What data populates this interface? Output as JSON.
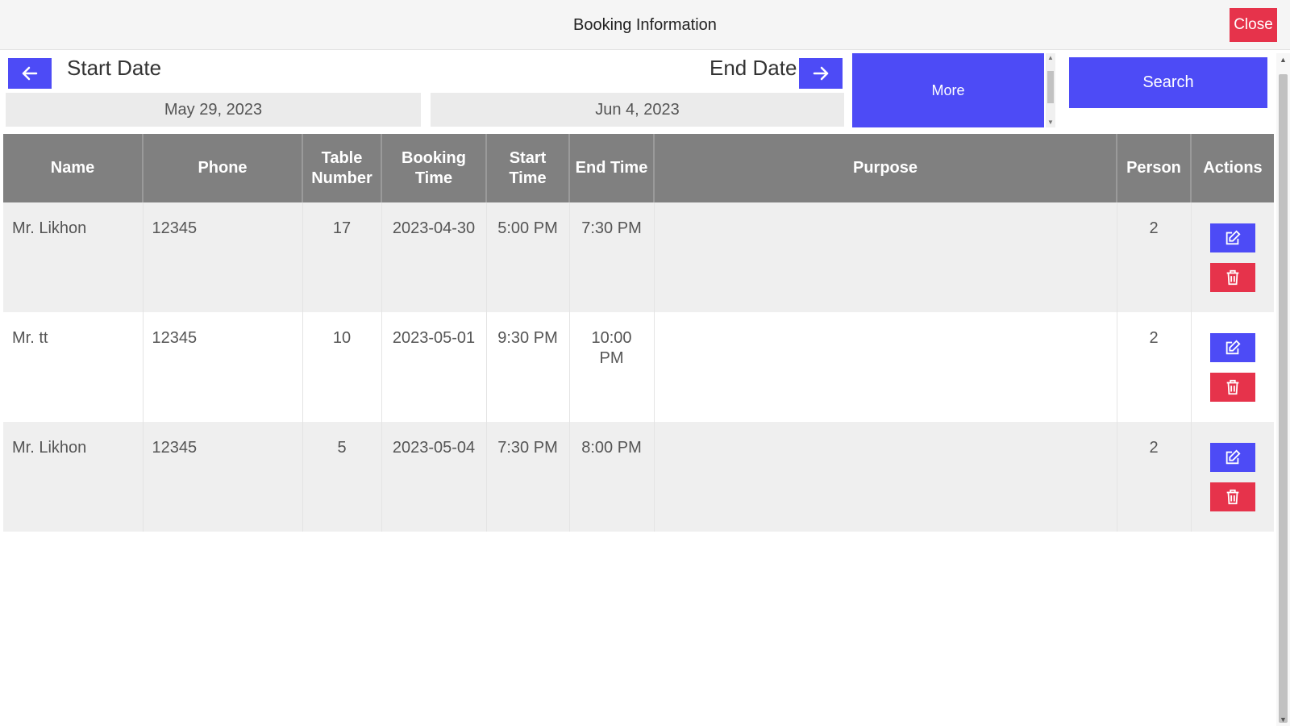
{
  "header": {
    "title": "Booking Information",
    "close_label": "Close"
  },
  "filters": {
    "start_label": "Start Date",
    "end_label": "End Date",
    "start_value": "May 29, 2023",
    "end_value": "Jun 4, 2023",
    "more_label": "More",
    "search_label": "Search",
    "prev_icon": "arrow-left-icon",
    "next_icon": "arrow-right-icon"
  },
  "table": {
    "columns": [
      "Name",
      "Phone",
      "Table Number",
      "Booking Time",
      "Start Time",
      "End Time",
      "Purpose",
      "Person",
      "Actions"
    ],
    "rows": [
      {
        "name": "Mr. Likhon",
        "phone": "12345",
        "table_number": "17",
        "booking_time": "2023-04-30",
        "start_time": "5:00 PM",
        "end_time": "7:30 PM",
        "purpose": "",
        "person": "2"
      },
      {
        "name": "Mr. tt",
        "phone": "12345",
        "table_number": "10",
        "booking_time": "2023-05-01",
        "start_time": "9:30 PM",
        "end_time": "10:00 PM",
        "purpose": "",
        "person": "2"
      },
      {
        "name": "Mr. Likhon",
        "phone": "12345",
        "table_number": "5",
        "booking_time": "2023-05-04",
        "start_time": "7:30 PM",
        "end_time": "8:00 PM",
        "purpose": "",
        "person": "2"
      }
    ],
    "edit_icon": "edit-icon",
    "delete_icon": "trash-icon"
  },
  "colors": {
    "primary": "#4d4bf6",
    "danger": "#e6334b",
    "header_bg": "#808080"
  }
}
